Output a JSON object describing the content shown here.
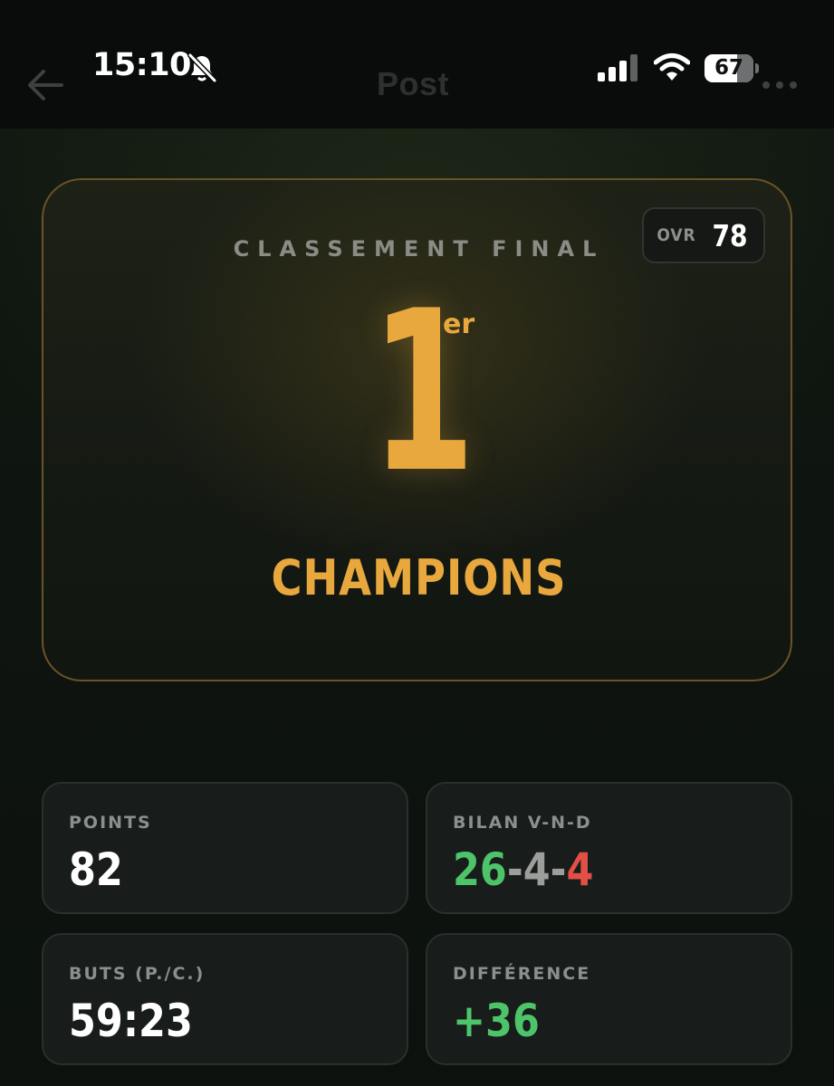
{
  "status_bar": {
    "time": "15:10",
    "battery_level": "67",
    "battery_fraction": 0.67,
    "icons": [
      "bell-slash-icon",
      "cellular-signal-icon",
      "wifi-icon",
      "battery-icon"
    ]
  },
  "nav": {
    "title": "Post",
    "back_icon": "arrow-left-icon",
    "more_icon": "more-dots-icon"
  },
  "hero": {
    "heading": "CLASSEMENT FINAL",
    "ovr_label": "OVR",
    "ovr_value": "78",
    "rank_number": "1",
    "rank_suffix": "er",
    "title": "CHAMPIONS"
  },
  "stats": {
    "points": {
      "label": "POINTS",
      "value": "82"
    },
    "record": {
      "label": "BILAN V-N-D",
      "wins": "26",
      "sep1": "-",
      "draws": "4",
      "sep2": "-",
      "losses": "4"
    },
    "goals": {
      "label": "BUTS (P./C.)",
      "value": "59:23"
    },
    "difference": {
      "label": "DIFFÉRENCE",
      "value": "+36"
    }
  },
  "colors": {
    "accent_gold": "#e8a83e",
    "win_green": "#4ec46a",
    "loss_red": "#e25045",
    "draw_grey": "#9c9e9c"
  }
}
